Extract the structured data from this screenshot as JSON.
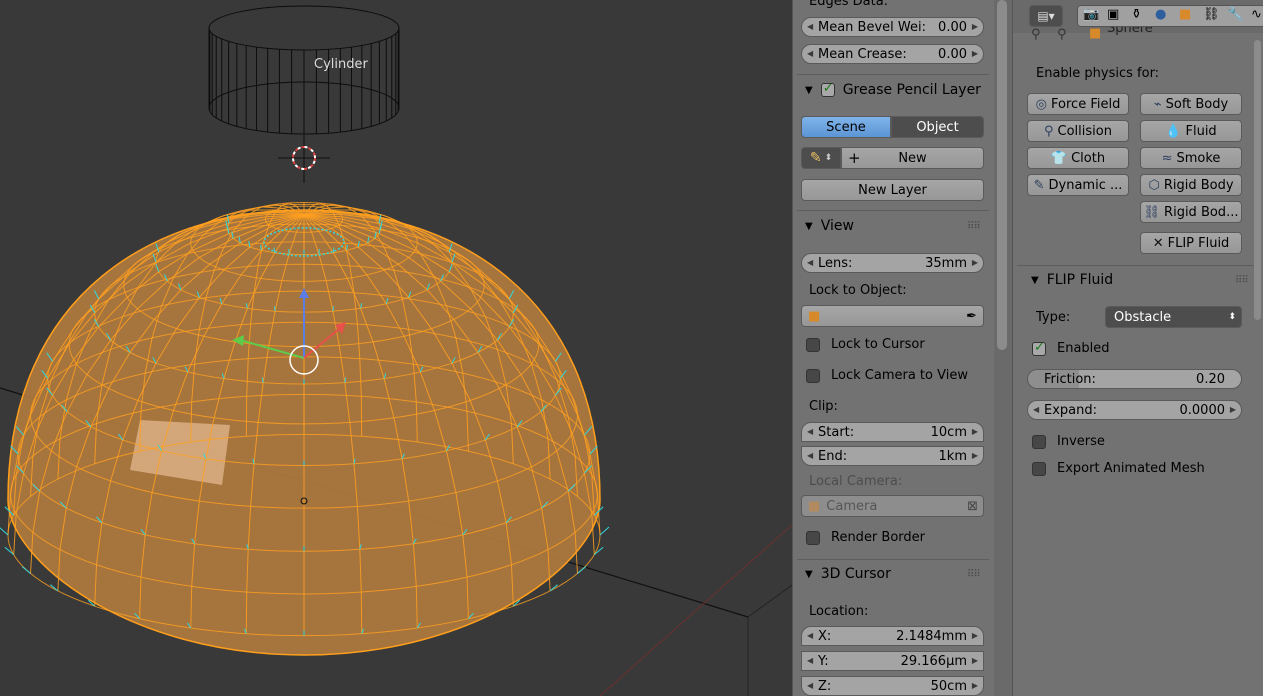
{
  "viewport": {
    "object_label": "Cylinder"
  },
  "npanel": {
    "edges_data_label": "Edges Data:",
    "mean_bevel": {
      "label": "Mean Bevel Wei:",
      "value": "0.00"
    },
    "mean_crease": {
      "label": "Mean Crease:",
      "value": "0.00"
    },
    "grease_pencil": {
      "title": "Grease Pencil Layer",
      "scene_tab": "Scene",
      "object_tab": "Object",
      "new_label": "New",
      "new_layer_label": "New Layer"
    },
    "view": {
      "title": "View",
      "lens": {
        "label": "Lens:",
        "value": "35mm"
      },
      "lock_object_label": "Lock to Object:",
      "lock_cursor": "Lock to Cursor",
      "lock_camera": "Lock Camera to View",
      "clip_label": "Clip:",
      "clip_start": {
        "label": "Start:",
        "value": "10cm"
      },
      "clip_end": {
        "label": "End:",
        "value": "1km"
      },
      "local_camera_label": "Local Camera:",
      "local_camera_value": "Camera",
      "render_border": "Render Border"
    },
    "cursor": {
      "title": "3D Cursor",
      "location_label": "Location:",
      "x": {
        "label": "X:",
        "value": "2.1484mm"
      },
      "y": {
        "label": "Y:",
        "value": "29.166µm"
      },
      "z": {
        "label": "Z:",
        "value": "50cm"
      }
    }
  },
  "properties": {
    "breadcrumb": "Sphere",
    "enable_physics_label": "Enable physics for:",
    "physics_buttons": {
      "force_field": "Force Field",
      "soft_body": "Soft Body",
      "collision": "Collision",
      "fluid": "Fluid",
      "cloth": "Cloth",
      "smoke": "Smoke",
      "dynamic": "Dynamic ...",
      "rigid_body": "Rigid Body",
      "rigid_body_constraint": "Rigid Bod...",
      "flip_fluid": "FLIP Fluid"
    },
    "flip_panel": {
      "title": "FLIP Fluid",
      "type_label": "Type:",
      "type_value": "Obstacle",
      "enabled": "Enabled",
      "friction": {
        "label": "Friction:",
        "value": "0.20"
      },
      "expand": {
        "label": "Expand:",
        "value": "0.0000"
      },
      "inverse": "Inverse",
      "export_animated": "Export Animated Mesh"
    }
  },
  "colors": {
    "viewport_bg": "#393939",
    "panel_bg": "#727272",
    "selection_orange": "#ffa020",
    "normal_cyan": "#2fd8e0",
    "tab_selected": "#6ea5e0"
  }
}
